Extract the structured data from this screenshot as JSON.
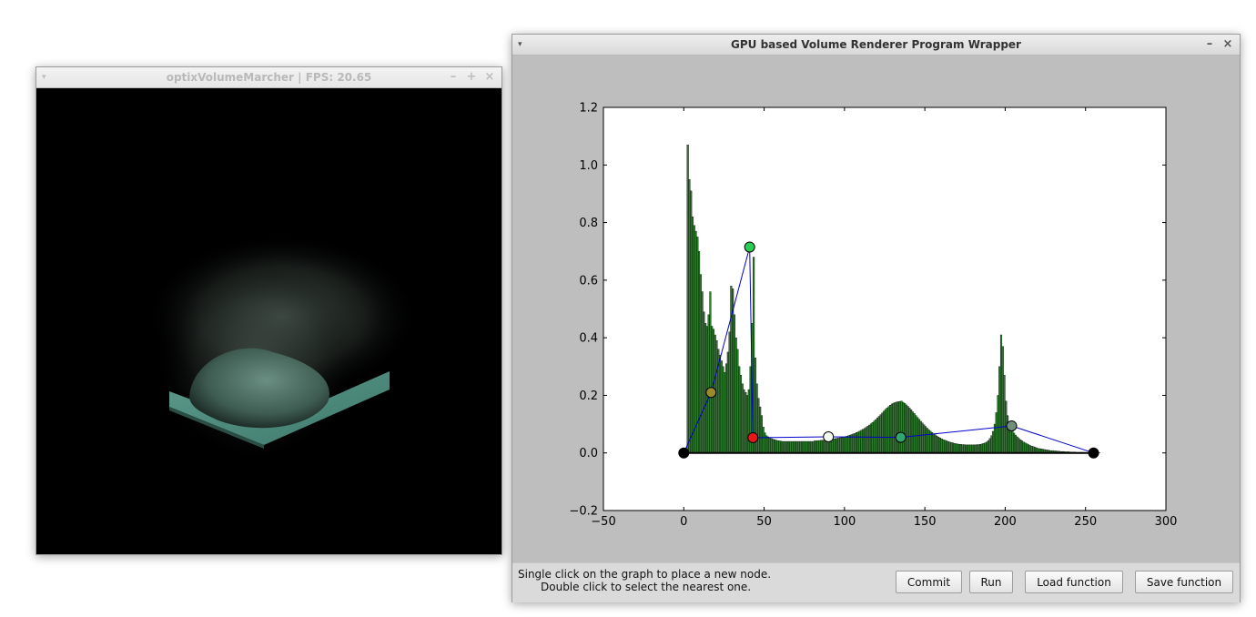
{
  "render_window": {
    "title": "optixVolumeMarcher | FPS:  20.65",
    "menu_icon": "▾",
    "controls": {
      "minimize": "–",
      "maximize": "+",
      "close": "×"
    }
  },
  "plot_window": {
    "title": "GPU based Volume Renderer Program Wrapper",
    "menu_icon": "▾",
    "controls": {
      "minimize": "–",
      "close": "×"
    }
  },
  "status": {
    "line1": "Single click on the graph to place a new node.",
    "line2": "Double click to select the nearest one."
  },
  "buttons": {
    "commit": "Commit",
    "run": "Run",
    "load": "Load function",
    "save": "Save function"
  },
  "chart_data": {
    "type": "bar",
    "xlim": [
      -50,
      300
    ],
    "ylim": [
      -0.2,
      1.2
    ],
    "xticks": [
      -50,
      0,
      50,
      100,
      150,
      200,
      250,
      300
    ],
    "yticks": [
      -0.2,
      0.0,
      0.2,
      0.4,
      0.6,
      0.8,
      1.0,
      1.2
    ],
    "histogram": {
      "bin_start": 0,
      "bin_width": 1,
      "color": "#2e7d2e",
      "values": [
        0.0,
        0.0,
        1.07,
        0.95,
        0.91,
        0.82,
        0.79,
        0.77,
        0.75,
        0.7,
        0.62,
        0.56,
        0.49,
        0.45,
        0.44,
        0.48,
        0.56,
        0.44,
        0.43,
        0.41,
        0.39,
        0.36,
        0.34,
        0.32,
        0.3,
        0.28,
        0.31,
        0.35,
        0.42,
        0.58,
        0.57,
        0.48,
        0.4,
        0.36,
        0.3,
        0.27,
        0.24,
        0.22,
        0.21,
        0.2,
        0.22,
        0.3,
        0.45,
        0.68,
        0.33,
        0.24,
        0.19,
        0.16,
        0.13,
        0.09,
        0.07,
        0.06,
        0.056,
        0.052,
        0.05,
        0.048,
        0.046,
        0.044,
        0.043,
        0.042,
        0.041,
        0.04,
        0.04,
        0.04,
        0.04,
        0.04,
        0.04,
        0.04,
        0.04,
        0.04,
        0.04,
        0.04,
        0.04,
        0.04,
        0.04,
        0.04,
        0.04,
        0.04,
        0.04,
        0.04,
        0.04,
        0.042,
        0.042,
        0.043,
        0.043,
        0.044,
        0.044,
        0.045,
        0.045,
        0.046,
        0.047,
        0.047,
        0.048,
        0.049,
        0.05,
        0.051,
        0.052,
        0.053,
        0.054,
        0.055,
        0.057,
        0.058,
        0.06,
        0.062,
        0.064,
        0.066,
        0.068,
        0.071,
        0.073,
        0.076,
        0.079,
        0.082,
        0.085,
        0.089,
        0.093,
        0.097,
        0.101,
        0.106,
        0.111,
        0.116,
        0.122,
        0.127,
        0.133,
        0.139,
        0.145,
        0.151,
        0.156,
        0.161,
        0.166,
        0.17,
        0.173,
        0.175,
        0.177,
        0.178,
        0.179,
        0.18,
        0.176,
        0.172,
        0.167,
        0.162,
        0.156,
        0.15,
        0.143,
        0.137,
        0.13,
        0.123,
        0.117,
        0.11,
        0.104,
        0.098,
        0.092,
        0.086,
        0.081,
        0.076,
        0.071,
        0.067,
        0.063,
        0.059,
        0.055,
        0.052,
        0.049,
        0.046,
        0.044,
        0.042,
        0.04,
        0.038,
        0.036,
        0.035,
        0.033,
        0.032,
        0.031,
        0.03,
        0.03,
        0.029,
        0.029,
        0.028,
        0.028,
        0.028,
        0.028,
        0.028,
        0.028,
        0.028,
        0.029,
        0.029,
        0.03,
        0.031,
        0.033,
        0.035,
        0.038,
        0.043,
        0.05,
        0.06,
        0.075,
        0.1,
        0.14,
        0.2,
        0.3,
        0.41,
        0.37,
        0.27,
        0.18,
        0.13,
        0.1,
        0.087,
        0.077,
        0.069,
        0.062,
        0.056,
        0.051,
        0.046,
        0.042,
        0.038,
        0.035,
        0.032,
        0.029,
        0.026,
        0.024,
        0.022,
        0.02,
        0.018,
        0.016,
        0.015,
        0.014,
        0.013,
        0.012,
        0.011,
        0.01,
        0.009,
        0.008,
        0.008,
        0.007,
        0.007,
        0.006,
        0.006,
        0.005,
        0.005,
        0.005,
        0.004,
        0.004,
        0.004,
        0.003,
        0.003,
        0.003,
        0.003,
        0.002,
        0.002,
        0.002,
        0.002,
        0.002,
        0.001,
        0.001,
        0.001,
        0.001,
        0.001,
        0.001,
        0.001,
        0.001,
        0.001,
        0.001
      ]
    },
    "transfer_function": {
      "line_color": "#0000cc",
      "nodes": [
        {
          "x": 0,
          "y": 0.0,
          "color": "#000000"
        },
        {
          "x": 17,
          "y": 0.21,
          "color": "#9b8a2a"
        },
        {
          "x": 41,
          "y": 0.715,
          "color": "#27d054"
        },
        {
          "x": 43,
          "y": 0.053,
          "color": "#e81818"
        },
        {
          "x": 90,
          "y": 0.056,
          "color": "#f2fbf2"
        },
        {
          "x": 135,
          "y": 0.054,
          "color": "#2ea86e"
        },
        {
          "x": 204,
          "y": 0.094,
          "color": "#6f8f7c"
        },
        {
          "x": 255,
          "y": 0.0,
          "color": "#000000"
        }
      ]
    },
    "baseline_segment": {
      "x": [
        0,
        255
      ],
      "y": 0.0,
      "color": "#000000"
    }
  }
}
